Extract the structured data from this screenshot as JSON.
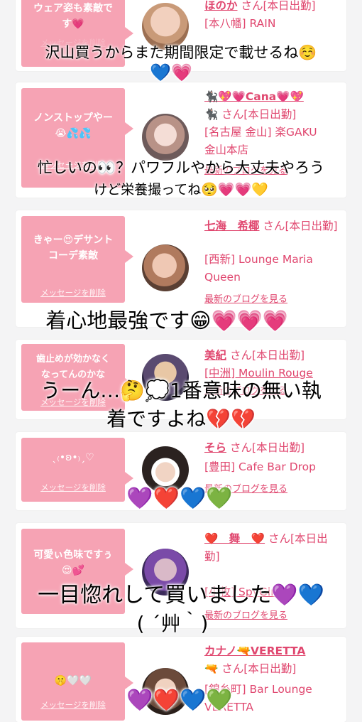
{
  "cards": [
    {
      "msg": "ウェア姿も素敵で\nす💗",
      "delete": "メッセージを削除",
      "name": "ほのか",
      "suffix": " さん[本日出勤]",
      "lines": [
        "[本八幡] RAIN"
      ],
      "blog": "最新のブログを見る"
    },
    {
      "msg": "ノンストップやー\n😭💦💦",
      "delete": "メッセージを削除",
      "name": "🐈‍⬛💖💗Cana💗💖",
      "suffix": "🐈‍⬛ さん[本日出勤]",
      "lines": [
        "[名古屋 金山] 楽GAKU",
        "金山本店"
      ],
      "blog": "最新のブログを見る"
    },
    {
      "msg": "きゃー😍デサント\nコーデ素敵",
      "delete": "メッセージを削除",
      "name": "七海　希椰",
      "suffix": " さん[本日出勤]",
      "lines": [
        "[西新] Lounge Maria",
        "Queen"
      ],
      "blog": "最新のブログを見る"
    },
    {
      "msg": "歯止めが効かなく\nなってんのかな",
      "delete": "メッセージを削除",
      "name": "美紀",
      "suffix": " さん[本日出勤]",
      "lines": [
        "[中洲] Moulin Rouge"
      ],
      "blog": "最新のブログを見る"
    },
    {
      "msg": "ˎ₍•ʚ•₎ˏ♡",
      "delete": "メッセージを削除",
      "name": "そら",
      "suffix": " さん[本日出勤]",
      "lines": [
        "[豊田] Cafe Bar Drop"
      ],
      "blog": "最新のブログを見る"
    },
    {
      "msg": "可愛ぃ色味ですぅ\n😍💕",
      "delete": "メッセージを削除",
      "name": "❤️　舞　❤️",
      "suffix": " さん[本日出勤]",
      "lines": [
        "[小牧] SpyGirls"
      ],
      "blog": "最新のブログを見る"
    },
    {
      "msg": "🤫🤍🤍",
      "delete": "メッセージを削除",
      "name": "カナノ🔫VERETTA",
      "suffix": "🔫 さん[本日出勤]",
      "lines": [
        "[錦糸町] Bar Lounge",
        "VERETTA"
      ],
      "blog": ""
    }
  ],
  "overlays": {
    "t1": "沢山買うからまた期間限定で載せるね☺️",
    "t1b": "💙💗",
    "t2a": "忙しいの👀？パワフルやから大丈夫やろう",
    "t2b": "けど栄養撮ってね🥺💗💗💛",
    "t3": "着心地最強です😁💗💗💗",
    "t4a": "うーん…🤔💭1番意味の無い執",
    "t4b": "着ですよね💔💔",
    "t5": "💜❤️💙💚",
    "t6a": "一目惚れして買いました💜💙",
    "t6b": "( ´艸｀)",
    "t7": "💜❤️💙💚"
  },
  "colors": {
    "accent": "#e0476f",
    "bubble": "#f6a3b4"
  }
}
